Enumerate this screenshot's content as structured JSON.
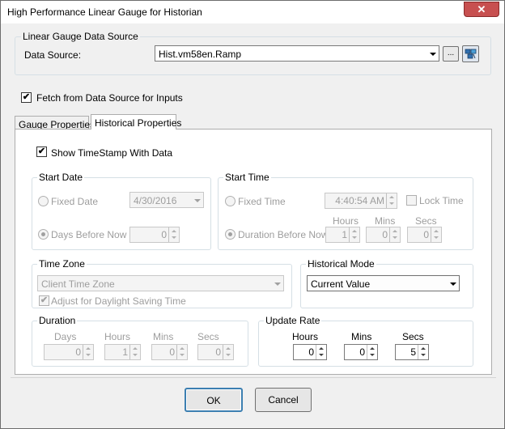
{
  "window": {
    "title": "High Performance Linear Gauge for Historian",
    "close_glyph": "✕"
  },
  "data_source_group": {
    "legend": "Linear Gauge Data Source",
    "label": "Data Source:",
    "value": "Hist.vm58en.Ramp",
    "browse_label": "..."
  },
  "fetch": {
    "label": "Fetch from Data Source for Inputs",
    "checked": true,
    "glyph": "✔"
  },
  "tabs": [
    {
      "label": "Gauge Properties",
      "active": false
    },
    {
      "label": "Historical Properties",
      "active": true
    }
  ],
  "historical": {
    "show_timestamp": {
      "label": "Show TimeStamp With Data",
      "checked": true,
      "glyph": "✔"
    },
    "start_date": {
      "legend": "Start Date",
      "fixed_date_label": "Fixed Date",
      "fixed_date_value": "4/30/2016",
      "days_before_label": "Days Before Now",
      "days_before_value": "0"
    },
    "start_time": {
      "legend": "Start Time",
      "fixed_time_label": "Fixed Time",
      "fixed_time_value": "4:40:54 AM",
      "lock_time_label": "Lock Time",
      "duration_before_label": "Duration Before Now",
      "hours_label": "Hours",
      "mins_label": "Mins",
      "secs_label": "Secs",
      "hours_value": "1",
      "mins_value": "0",
      "secs_value": "0"
    },
    "time_zone": {
      "legend": "Time Zone",
      "value": "Client Time Zone",
      "dst_label": "Adjust for Daylight Saving Time",
      "dst_checked": true,
      "glyph": "✔"
    },
    "historical_mode": {
      "legend": "Historical Mode",
      "value": "Current Value"
    },
    "duration": {
      "legend": "Duration",
      "days_label": "Days",
      "hours_label": "Hours",
      "mins_label": "Mins",
      "secs_label": "Secs",
      "days_value": "0",
      "hours_value": "1",
      "mins_value": "0",
      "secs_value": "0"
    },
    "update_rate": {
      "legend": "Update Rate",
      "hours_label": "Hours",
      "mins_label": "Mins",
      "secs_label": "Secs",
      "hours_value": "0",
      "mins_value": "0",
      "secs_value": "5"
    }
  },
  "buttons": {
    "ok_label": "OK",
    "cancel_label": "Cancel"
  },
  "icons": [
    "close-icon",
    "browse-icon",
    "tag-browser-icon",
    "checkmark-icon",
    "dropdown-arrow-icon",
    "spin-up-icon",
    "spin-down-icon"
  ]
}
